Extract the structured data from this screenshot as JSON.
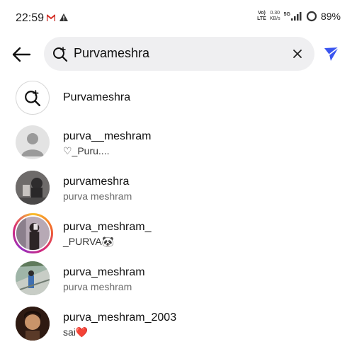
{
  "status_bar": {
    "time": "22:59",
    "network_line1": "Vo)",
    "network_line2": "LTE",
    "speed_line1": "0.30",
    "speed_line2": "KB/s",
    "sig_label": "5G",
    "battery": "89%"
  },
  "search": {
    "value": "Purvameshra",
    "accent_color": "#3a55f0"
  },
  "results": [
    {
      "type": "query",
      "title": "Purvameshra"
    },
    {
      "type": "user",
      "username": "purva__meshram",
      "subtitle": "♡_Puru....",
      "avatar": "default-avatar"
    },
    {
      "type": "user",
      "username": "purvameshra",
      "subtitle": "purva meshram",
      "avatar": "photo-avatar"
    },
    {
      "type": "user",
      "username": "purva_meshram_",
      "subtitle": "_PURVA🐼",
      "avatar": "story-ring-avatar"
    },
    {
      "type": "user",
      "username": "purva_meshram",
      "subtitle": "purva meshram",
      "avatar": "photo-avatar"
    },
    {
      "type": "user",
      "username": "purva_meshram_2003",
      "subtitle": "sai❤️",
      "avatar": "photo-avatar"
    }
  ]
}
